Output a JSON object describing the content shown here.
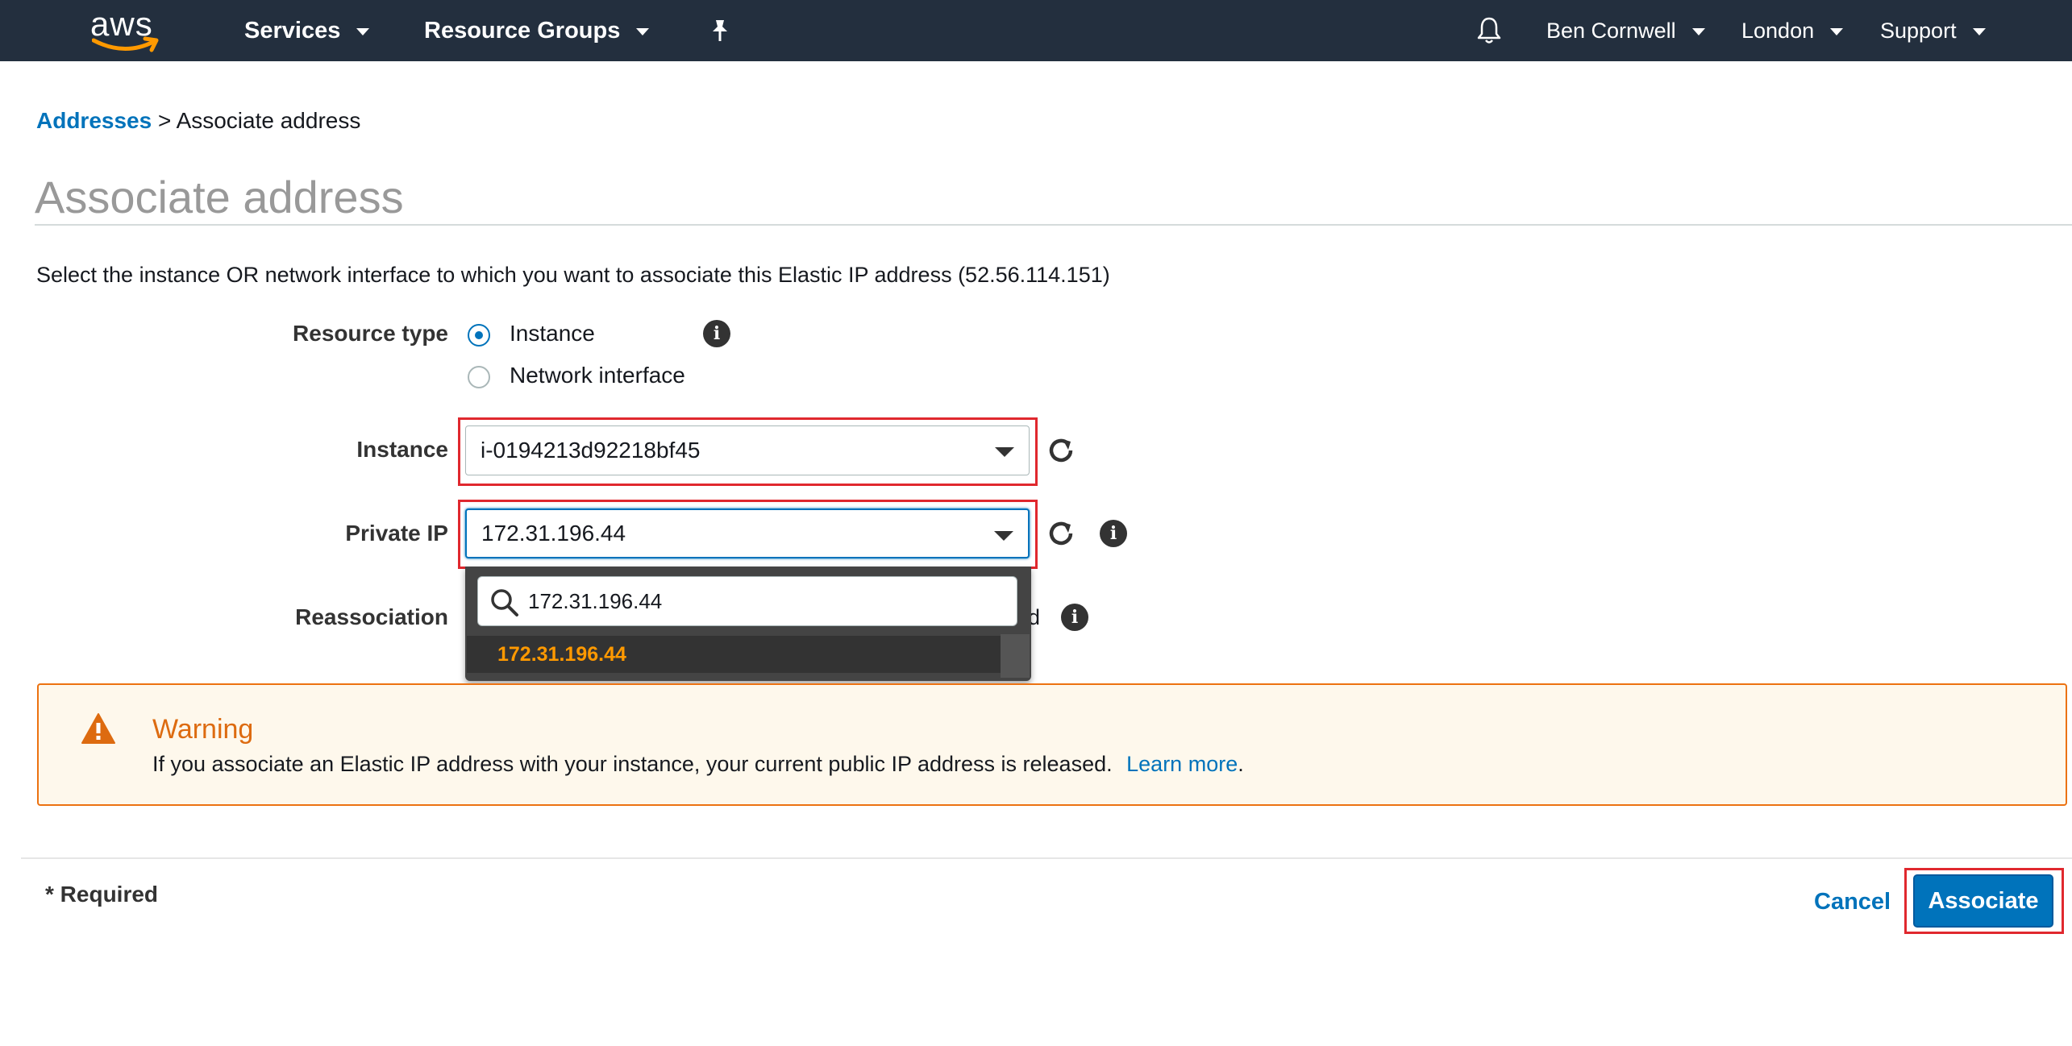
{
  "nav": {
    "logo": "aws",
    "services": "Services",
    "resource_groups": "Resource Groups",
    "user": "Ben Cornwell",
    "region": "London",
    "support": "Support"
  },
  "breadcrumb": {
    "link": "Addresses",
    "separator": ">",
    "current": "Associate address"
  },
  "page": {
    "title": "Associate address",
    "intro": "Select the instance OR network interface to which you want to associate this Elastic IP address (52.56.114.151)"
  },
  "form": {
    "resource_type_label": "Resource type",
    "resource_type_options": [
      "Instance",
      "Network interface"
    ],
    "resource_type_selected": "Instance",
    "instance_label": "Instance",
    "instance_value": "i-0194213d92218bf45",
    "private_ip_label": "Private IP",
    "private_ip_value": "172.31.196.44",
    "reassociation_label": "Reassociation",
    "reassociation_tail": "ed"
  },
  "dropdown": {
    "search_value": "172.31.196.44",
    "options": [
      "172.31.196.44"
    ]
  },
  "warning": {
    "title": "Warning",
    "text": "If you associate an Elastic IP address with your instance, your current public IP address is released.",
    "link": "Learn more",
    "trailing": "."
  },
  "footer": {
    "required": "* Required",
    "cancel": "Cancel",
    "associate": "Associate"
  },
  "colors": {
    "nav_bg": "#232f3e",
    "link": "#0073bb",
    "primary_button": "#0073bb",
    "warning_accent": "#ec7211",
    "highlight": "#e0282e",
    "dropdown_option": "#ff9900"
  },
  "icons": [
    "aws-logo",
    "chevron-down-icon",
    "pin-icon",
    "bell-icon",
    "info-icon",
    "refresh-icon",
    "search-icon",
    "warning-icon"
  ]
}
